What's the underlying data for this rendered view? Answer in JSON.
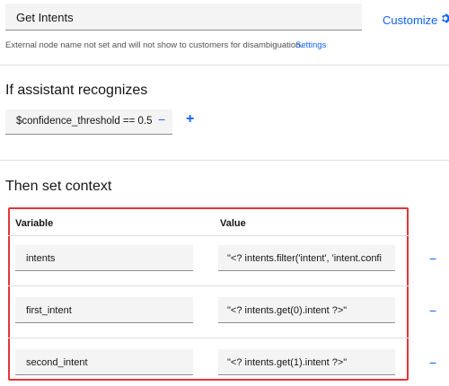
{
  "node": {
    "name_value": "Get Intents",
    "customize_label": "Customize",
    "external_note": "External node name not set and will not show to customers for disambiguation.",
    "settings_label": "Settings"
  },
  "condition_section": {
    "heading": "If assistant recognizes",
    "condition_value": "$confidence_threshold == 0.5",
    "remove_label": "−",
    "add_label": "+"
  },
  "context_section": {
    "heading": "Then set context",
    "columns": {
      "variable": "Variable",
      "value": "Value"
    },
    "remove_label": "−",
    "rows": [
      {
        "variable": "intents",
        "value": "\"<? intents.filter('intent', 'intent.confi"
      },
      {
        "variable": "first_intent",
        "value": "\"<?  intents.get(0).intent ?>\""
      },
      {
        "variable": "second_intent",
        "value": "\"<?  intents.get(1).intent ?>\""
      }
    ]
  },
  "colors": {
    "link": "#0f62fe",
    "highlight": "#e5343b",
    "field_bg": "#f4f4f4"
  },
  "icons": {
    "customize": "gear-icon"
  }
}
